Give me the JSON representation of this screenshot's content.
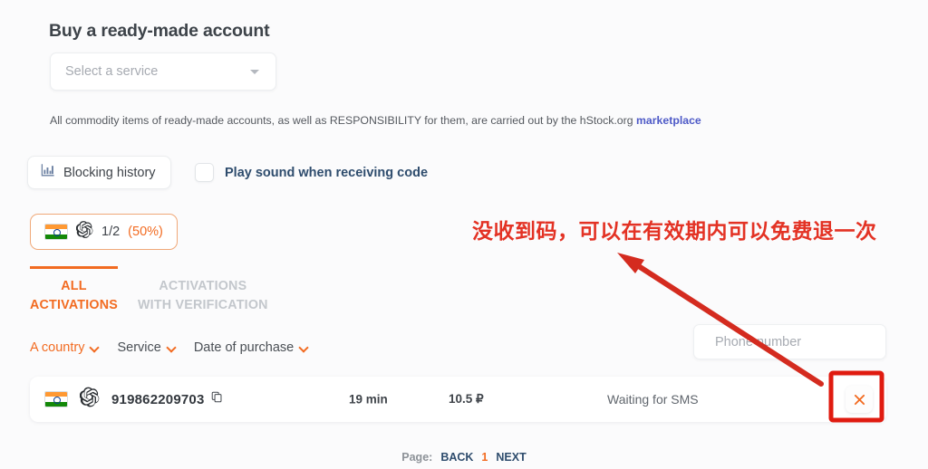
{
  "header": {
    "title": "Buy a ready-made account"
  },
  "service_select": {
    "placeholder": "Select a service",
    "value": "",
    "caret_icon": "chevron-down-icon"
  },
  "notice": {
    "text": "All commodity items of ready-made accounts, as well as RESPONSIBILITY for them, are carried out by the hStock.org ",
    "link_text": "marketplace"
  },
  "toolbar": {
    "blocking_history_label": "Blocking history",
    "blocking_history_icon": "bar-chart-icon",
    "play_sound_label": "Play sound when receiving code",
    "play_sound_checked": false
  },
  "counter": {
    "flag_icon": "flag-india-icon",
    "service_icon": "openai-logo-icon",
    "fraction": "1/2",
    "percent": "(50%)"
  },
  "tabs": [
    {
      "label": "ALL ACTIVATIONS",
      "line1": "ALL",
      "line2": "ACTIVATIONS",
      "active": true
    },
    {
      "label": "ACTIVATIONS WITH VERIFICATION",
      "line1": "ACTIVATIONS",
      "line2": "WITH VERIFICATION",
      "active": false
    }
  ],
  "filters": [
    {
      "label": "A country",
      "active": true
    },
    {
      "label": "Service",
      "active": false
    },
    {
      "label": "Date of purchase",
      "active": false
    }
  ],
  "search": {
    "phone_placeholder": "Phone number",
    "phone_value": ""
  },
  "table": {
    "rows": [
      {
        "flag_icon": "flag-india-icon",
        "service_icon": "openai-logo-icon",
        "number": "919862209703",
        "copy_icon": "copy-icon",
        "time_left": "19 min",
        "price": "10.5 ₽",
        "status": "Waiting for SMS",
        "cancel_icon": "close-icon"
      }
    ]
  },
  "pagination": {
    "label": "Page:",
    "back": "BACK",
    "current": "1",
    "next": "NEXT"
  },
  "annotations": {
    "note_text": "没收到码，可以在有效期内可以免费退一次",
    "arrow": "red-arrow",
    "highlight_box": "red-highlight-rectangle"
  },
  "colors": {
    "accent_orange": "#f26b21",
    "link_blue": "#4e5ac7",
    "navy": "#2e4c6d",
    "annotation_red": "#e33224",
    "background": "#fbfbfc"
  }
}
